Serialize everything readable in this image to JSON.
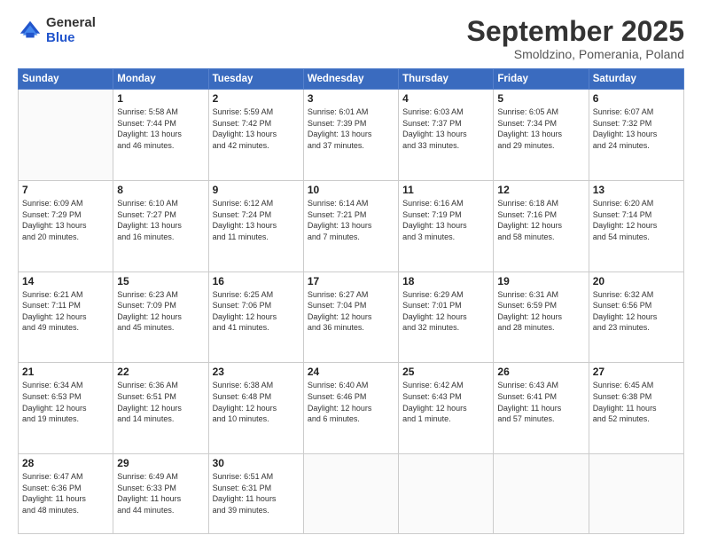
{
  "logo": {
    "general": "General",
    "blue": "Blue"
  },
  "header": {
    "month": "September 2025",
    "location": "Smoldzino, Pomerania, Poland"
  },
  "weekdays": [
    "Sunday",
    "Monday",
    "Tuesday",
    "Wednesday",
    "Thursday",
    "Friday",
    "Saturday"
  ],
  "weeks": [
    [
      {
        "day": "",
        "info": ""
      },
      {
        "day": "1",
        "info": "Sunrise: 5:58 AM\nSunset: 7:44 PM\nDaylight: 13 hours\nand 46 minutes."
      },
      {
        "day": "2",
        "info": "Sunrise: 5:59 AM\nSunset: 7:42 PM\nDaylight: 13 hours\nand 42 minutes."
      },
      {
        "day": "3",
        "info": "Sunrise: 6:01 AM\nSunset: 7:39 PM\nDaylight: 13 hours\nand 37 minutes."
      },
      {
        "day": "4",
        "info": "Sunrise: 6:03 AM\nSunset: 7:37 PM\nDaylight: 13 hours\nand 33 minutes."
      },
      {
        "day": "5",
        "info": "Sunrise: 6:05 AM\nSunset: 7:34 PM\nDaylight: 13 hours\nand 29 minutes."
      },
      {
        "day": "6",
        "info": "Sunrise: 6:07 AM\nSunset: 7:32 PM\nDaylight: 13 hours\nand 24 minutes."
      }
    ],
    [
      {
        "day": "7",
        "info": "Sunrise: 6:09 AM\nSunset: 7:29 PM\nDaylight: 13 hours\nand 20 minutes."
      },
      {
        "day": "8",
        "info": "Sunrise: 6:10 AM\nSunset: 7:27 PM\nDaylight: 13 hours\nand 16 minutes."
      },
      {
        "day": "9",
        "info": "Sunrise: 6:12 AM\nSunset: 7:24 PM\nDaylight: 13 hours\nand 11 minutes."
      },
      {
        "day": "10",
        "info": "Sunrise: 6:14 AM\nSunset: 7:21 PM\nDaylight: 13 hours\nand 7 minutes."
      },
      {
        "day": "11",
        "info": "Sunrise: 6:16 AM\nSunset: 7:19 PM\nDaylight: 13 hours\nand 3 minutes."
      },
      {
        "day": "12",
        "info": "Sunrise: 6:18 AM\nSunset: 7:16 PM\nDaylight: 12 hours\nand 58 minutes."
      },
      {
        "day": "13",
        "info": "Sunrise: 6:20 AM\nSunset: 7:14 PM\nDaylight: 12 hours\nand 54 minutes."
      }
    ],
    [
      {
        "day": "14",
        "info": "Sunrise: 6:21 AM\nSunset: 7:11 PM\nDaylight: 12 hours\nand 49 minutes."
      },
      {
        "day": "15",
        "info": "Sunrise: 6:23 AM\nSunset: 7:09 PM\nDaylight: 12 hours\nand 45 minutes."
      },
      {
        "day": "16",
        "info": "Sunrise: 6:25 AM\nSunset: 7:06 PM\nDaylight: 12 hours\nand 41 minutes."
      },
      {
        "day": "17",
        "info": "Sunrise: 6:27 AM\nSunset: 7:04 PM\nDaylight: 12 hours\nand 36 minutes."
      },
      {
        "day": "18",
        "info": "Sunrise: 6:29 AM\nSunset: 7:01 PM\nDaylight: 12 hours\nand 32 minutes."
      },
      {
        "day": "19",
        "info": "Sunrise: 6:31 AM\nSunset: 6:59 PM\nDaylight: 12 hours\nand 28 minutes."
      },
      {
        "day": "20",
        "info": "Sunrise: 6:32 AM\nSunset: 6:56 PM\nDaylight: 12 hours\nand 23 minutes."
      }
    ],
    [
      {
        "day": "21",
        "info": "Sunrise: 6:34 AM\nSunset: 6:53 PM\nDaylight: 12 hours\nand 19 minutes."
      },
      {
        "day": "22",
        "info": "Sunrise: 6:36 AM\nSunset: 6:51 PM\nDaylight: 12 hours\nand 14 minutes."
      },
      {
        "day": "23",
        "info": "Sunrise: 6:38 AM\nSunset: 6:48 PM\nDaylight: 12 hours\nand 10 minutes."
      },
      {
        "day": "24",
        "info": "Sunrise: 6:40 AM\nSunset: 6:46 PM\nDaylight: 12 hours\nand 6 minutes."
      },
      {
        "day": "25",
        "info": "Sunrise: 6:42 AM\nSunset: 6:43 PM\nDaylight: 12 hours\nand 1 minute."
      },
      {
        "day": "26",
        "info": "Sunrise: 6:43 AM\nSunset: 6:41 PM\nDaylight: 11 hours\nand 57 minutes."
      },
      {
        "day": "27",
        "info": "Sunrise: 6:45 AM\nSunset: 6:38 PM\nDaylight: 11 hours\nand 52 minutes."
      }
    ],
    [
      {
        "day": "28",
        "info": "Sunrise: 6:47 AM\nSunset: 6:36 PM\nDaylight: 11 hours\nand 48 minutes."
      },
      {
        "day": "29",
        "info": "Sunrise: 6:49 AM\nSunset: 6:33 PM\nDaylight: 11 hours\nand 44 minutes."
      },
      {
        "day": "30",
        "info": "Sunrise: 6:51 AM\nSunset: 6:31 PM\nDaylight: 11 hours\nand 39 minutes."
      },
      {
        "day": "",
        "info": ""
      },
      {
        "day": "",
        "info": ""
      },
      {
        "day": "",
        "info": ""
      },
      {
        "day": "",
        "info": ""
      }
    ]
  ]
}
